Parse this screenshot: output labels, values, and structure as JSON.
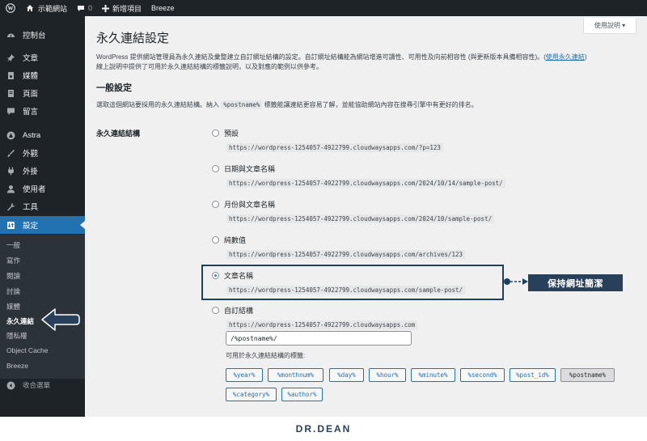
{
  "admin_bar": {
    "site_name": "示範網站",
    "comment_count": "0",
    "new_label": "新增項目",
    "plugin_label": "Breeze"
  },
  "sidebar": {
    "items": [
      {
        "label": "控制台",
        "icon": "dashboard-icon"
      },
      {
        "label": "文章",
        "icon": "pin-icon"
      },
      {
        "label": "媒體",
        "icon": "media-icon"
      },
      {
        "label": "頁面",
        "icon": "page-icon"
      },
      {
        "label": "留言",
        "icon": "comment-icon"
      },
      {
        "label": "Astra",
        "icon": "astra-icon"
      },
      {
        "label": "外觀",
        "icon": "brush-icon"
      },
      {
        "label": "外掛",
        "icon": "plugin-icon"
      },
      {
        "label": "使用者",
        "icon": "user-icon"
      },
      {
        "label": "工具",
        "icon": "wrench-icon"
      },
      {
        "label": "設定",
        "icon": "settings-icon"
      }
    ],
    "submenu": [
      "一般",
      "寫作",
      "閱讀",
      "討論",
      "媒體",
      "永久連結",
      "隱私權",
      "Object Cache",
      "Breeze"
    ],
    "collapse_label": "收合選單"
  },
  "header": {
    "help_label": "使用說明 ▾",
    "title": "永久連結設定"
  },
  "intro": {
    "line1": "WordPress 提供網站管理員為永久連結及彙整建立自訂網址結構的設定。自訂網址結構能為網站增進可讀性、可用性及向前相容性 (與更新版本具備相容性)。",
    "link": "使用永久連結",
    "line2": "線上說明中提供了可用於永久連結結構的標籤說明，以及對應的範例以供參考。"
  },
  "common": {
    "title": "一般設定",
    "desc_before": "選取這個網站要採用的永久連結結構。納入",
    "desc_code": "%postname%",
    "desc_after": "標籤能讓連結更容易了解，並能協助網站內容在搜尋引擎中有更好的排名。",
    "field_label": "永久連結結構"
  },
  "options": [
    {
      "label": "預設",
      "url": "https://wordpress-1254057-4922799.cloudwaysapps.com/?p=123",
      "checked": false
    },
    {
      "label": "日期與文章名稱",
      "url": "https://wordpress-1254057-4922799.cloudwaysapps.com/2024/10/14/sample-post/",
      "checked": false
    },
    {
      "label": "月份與文章名稱",
      "url": "https://wordpress-1254057-4922799.cloudwaysapps.com/2024/10/sample-post/",
      "checked": false
    },
    {
      "label": "純數值",
      "url": "https://wordpress-1254057-4922799.cloudwaysapps.com/archives/123",
      "checked": false
    },
    {
      "label": "文章名稱",
      "url": "https://wordpress-1254057-4922799.cloudwaysapps.com/sample-post/",
      "checked": true
    },
    {
      "label": "自訂結構",
      "url": "https://wordpress-1254057-4922799.cloudwaysapps.com",
      "checked": false
    }
  ],
  "custom_structure_value": "/%postname%/",
  "tags_label": "可用於永久連結結構的標籤:",
  "tags": [
    "%year%",
    "%monthnum%",
    "%day%",
    "%hour%",
    "%minute%",
    "%second%",
    "%post_id%",
    "%postname%",
    "%category%",
    "%author%"
  ],
  "active_tag": "%postname%",
  "callout_text": "保持網址簡潔",
  "footer_logo": "DR.DEAN",
  "colors": {
    "accent": "#2271b1",
    "sidebar": "#1d2327",
    "callout": "#28405a"
  }
}
